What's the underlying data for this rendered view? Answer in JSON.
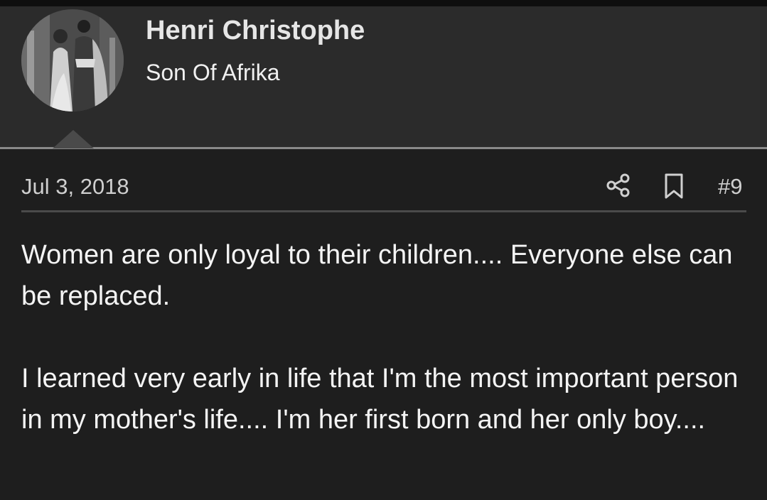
{
  "user": {
    "name": "Henri Christophe",
    "title": "Son Of Afrika"
  },
  "post": {
    "date": "Jul 3, 2018",
    "number": "#9",
    "paragraphs": [
      "Women are only loyal to their children.... Everyone else can be replaced.",
      "I learned very early in life that I'm the most important person in my mother's life.... I'm her first born and her only boy...."
    ]
  },
  "icons": {
    "share": "share-icon",
    "bookmark": "bookmark-icon"
  }
}
